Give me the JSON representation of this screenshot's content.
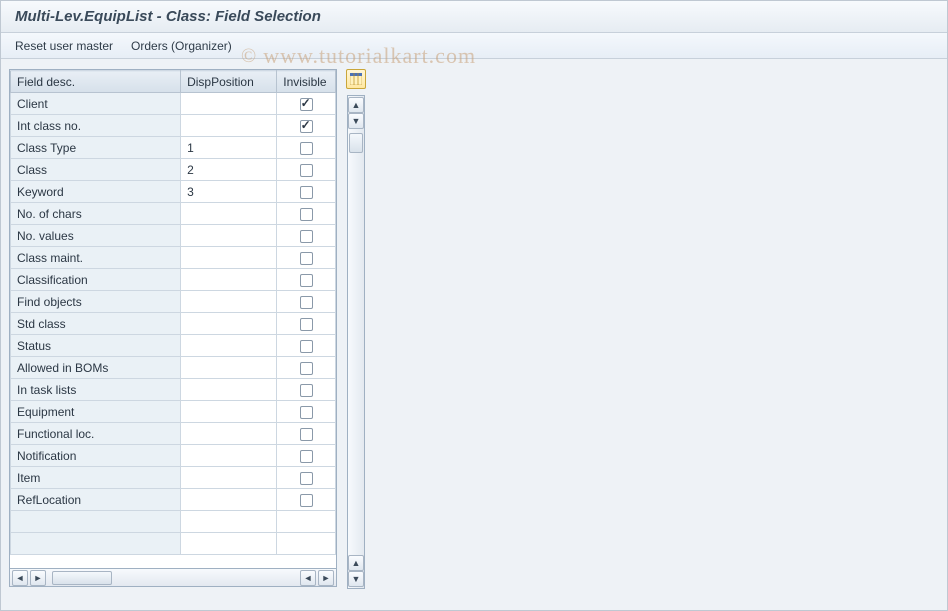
{
  "header": {
    "title": "Multi-Lev.EquipList - Class: Field Selection"
  },
  "toolbar": {
    "reset_label": "Reset user master",
    "orders_label": "Orders (Organizer)"
  },
  "watermark": {
    "symbol": "©",
    "text": "www.tutorialkart.com"
  },
  "table": {
    "columns": {
      "desc": "Field desc.",
      "disp": "DispPosition",
      "inv": "Invisible"
    },
    "rows": [
      {
        "desc": "Client",
        "disp": "",
        "invisible": true
      },
      {
        "desc": "Int class no.",
        "disp": "",
        "invisible": true
      },
      {
        "desc": "Class Type",
        "disp": "1",
        "invisible": false
      },
      {
        "desc": "Class",
        "disp": "2",
        "invisible": false
      },
      {
        "desc": "Keyword",
        "disp": "3",
        "invisible": false
      },
      {
        "desc": "No. of chars",
        "disp": "",
        "invisible": false
      },
      {
        "desc": "No. values",
        "disp": "",
        "invisible": false
      },
      {
        "desc": "Class maint.",
        "disp": "",
        "invisible": false
      },
      {
        "desc": "Classification",
        "disp": "",
        "invisible": false
      },
      {
        "desc": "Find objects",
        "disp": "",
        "invisible": false
      },
      {
        "desc": "Std class",
        "disp": "",
        "invisible": false
      },
      {
        "desc": "Status",
        "disp": "",
        "invisible": false
      },
      {
        "desc": "Allowed in BOMs",
        "disp": "",
        "invisible": false
      },
      {
        "desc": "In task lists",
        "disp": "",
        "invisible": false
      },
      {
        "desc": "Equipment",
        "disp": "",
        "invisible": false
      },
      {
        "desc": "Functional loc.",
        "disp": "",
        "invisible": false
      },
      {
        "desc": "Notification",
        "disp": "",
        "invisible": false
      },
      {
        "desc": "Item",
        "disp": "",
        "invisible": false
      },
      {
        "desc": "RefLocation",
        "disp": "",
        "invisible": false
      },
      {
        "desc": "",
        "disp": "",
        "invisible": null
      },
      {
        "desc": "",
        "disp": "",
        "invisible": null
      }
    ]
  },
  "icons": {
    "left": "◄",
    "right": "►",
    "up": "▲",
    "down": "▼"
  }
}
